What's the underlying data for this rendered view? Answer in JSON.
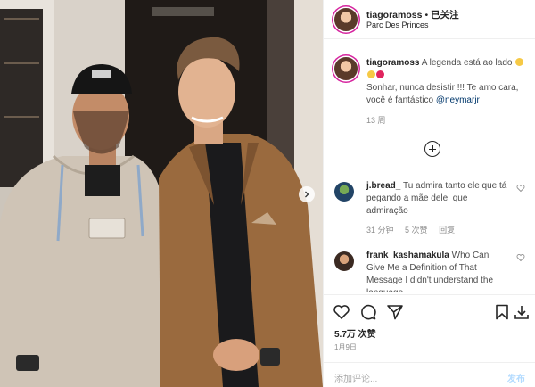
{
  "post": {
    "username": "tiagoramoss",
    "separator": "•",
    "follow_status": "已关注",
    "location": "Parc Des Princes"
  },
  "caption": {
    "username": "tiagoramoss",
    "line1": "A legenda está ao lado",
    "line2": "Sonhar, nunca desistir !!! Te amo cara, você é fantástico",
    "mention": "@neymarjr",
    "time": "13 周",
    "emoji_colors": [
      "#f6c945",
      "#f6c945",
      "#e0245e"
    ]
  },
  "comments": [
    {
      "username": "j.bread_",
      "text": "Tu admira tanto ele que tá pegando a mãe dele. que admiração",
      "time": "31 分钟",
      "likes": "5 次赞",
      "reply": "回复"
    },
    {
      "username": "frank_kashamakula",
      "text": "Who Can Give Me a Definition of That Message I didn't understand the language"
    }
  ],
  "actions": {
    "likes": "5.7万 次赞",
    "date": "1月9日",
    "add_comment_placeholder": "添加评论...",
    "post_button": "发布"
  },
  "icons": {
    "heart": "heart-icon",
    "comment": "comment-icon",
    "share": "share-icon",
    "save": "bookmark-icon",
    "download": "download-icon",
    "add_more": "plus-circle-icon",
    "next": "chevron-right-icon"
  }
}
